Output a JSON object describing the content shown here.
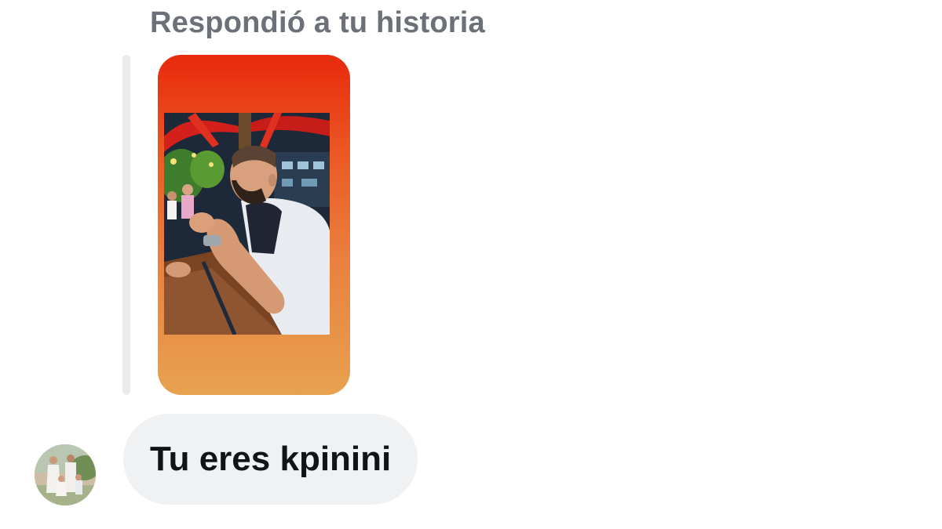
{
  "conversation": {
    "reply_context": "Respondió a tu historia",
    "message": {
      "text": "Tu eres kpinini"
    }
  },
  "story": {
    "background_top": "#e8290d",
    "background_bottom": "#e7a24f",
    "image": "story-photo-man-seated-at-bar"
  },
  "sender": {
    "avatar": "family-photo-avatar"
  },
  "colors": {
    "bubble": "#f0f1f3",
    "label": "#6b7079",
    "quote_bar": "#e9ebee"
  }
}
